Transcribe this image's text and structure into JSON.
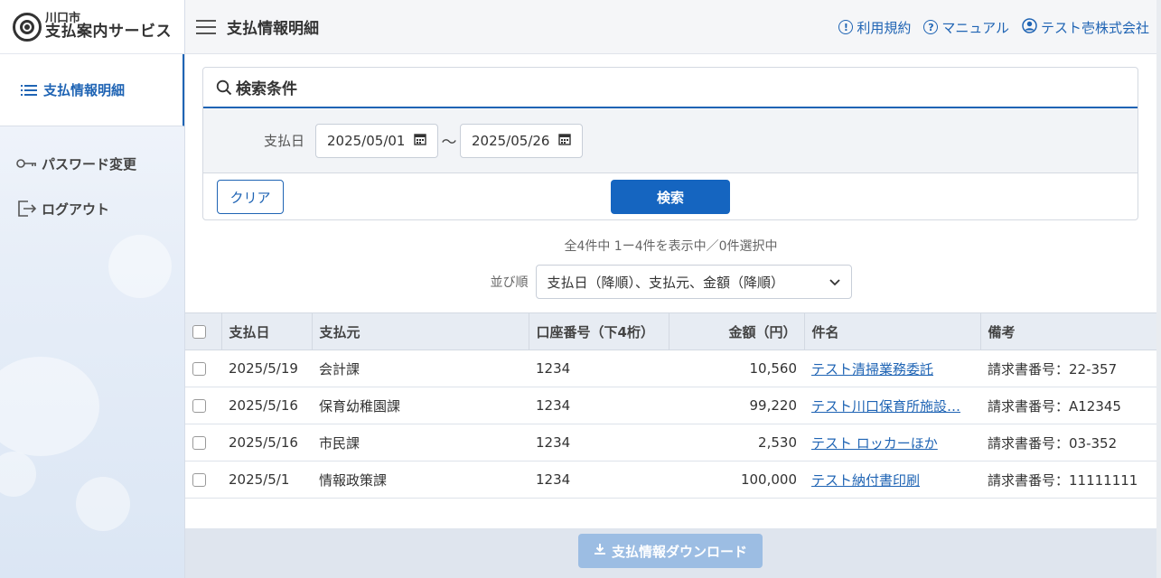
{
  "brand": {
    "city": "川口市",
    "service": "支払案内サービス"
  },
  "sidebar": {
    "items": [
      {
        "label": "支払情報明細",
        "icon": "list-icon",
        "active": true
      },
      {
        "label": "パスワード変更",
        "icon": "key-icon"
      },
      {
        "label": "ログアウト",
        "icon": "logout-icon"
      }
    ]
  },
  "header": {
    "title": "支払情報明細",
    "links": [
      {
        "label": "利用規約",
        "icon": "info-circle-icon"
      },
      {
        "label": "マニュアル",
        "icon": "question-circle-icon"
      },
      {
        "label": "テスト壱株式会社",
        "icon": "user-circle-icon"
      }
    ]
  },
  "search": {
    "title": "検索条件",
    "date_label": "支払日",
    "date_from": "2025/05/01",
    "date_to": "2025/05/26",
    "separator": "〜",
    "clear_label": "クリア",
    "search_label": "検索"
  },
  "results": {
    "count_text": "全4件中 1ー4件を表示中／0件選択中",
    "sort_label": "並び順",
    "sort_value": "支払日（降順）、支払元、金額（降順）"
  },
  "table": {
    "columns": [
      "支払日",
      "支払元",
      "口座番号（下4桁）",
      "金額（円）",
      "件名",
      "備考"
    ],
    "rows": [
      {
        "date": "2025/5/19",
        "payer": "会計課",
        "account": "1234",
        "amount": "10,560",
        "subject": "テスト清掃業務委託",
        "note": "請求書番号：22-357"
      },
      {
        "date": "2025/5/16",
        "payer": "保育幼稚園課",
        "account": "1234",
        "amount": "99,220",
        "subject": "テスト川口保育所施設…",
        "note": "請求書番号：A12345"
      },
      {
        "date": "2025/5/16",
        "payer": "市民課",
        "account": "1234",
        "amount": "2,530",
        "subject": "テスト ロッカーほか",
        "note": "請求書番号：03-352"
      },
      {
        "date": "2025/5/1",
        "payer": "情報政策課",
        "account": "1234",
        "amount": "100,000",
        "subject": "テスト納付書印刷",
        "note": "請求書番号：11111111"
      }
    ]
  },
  "footer": {
    "download_label": "支払情報ダウンロード"
  },
  "colors": {
    "accent": "#1f64b4",
    "primary_button": "#1565c0",
    "disabled_button": "#9cbde3"
  }
}
